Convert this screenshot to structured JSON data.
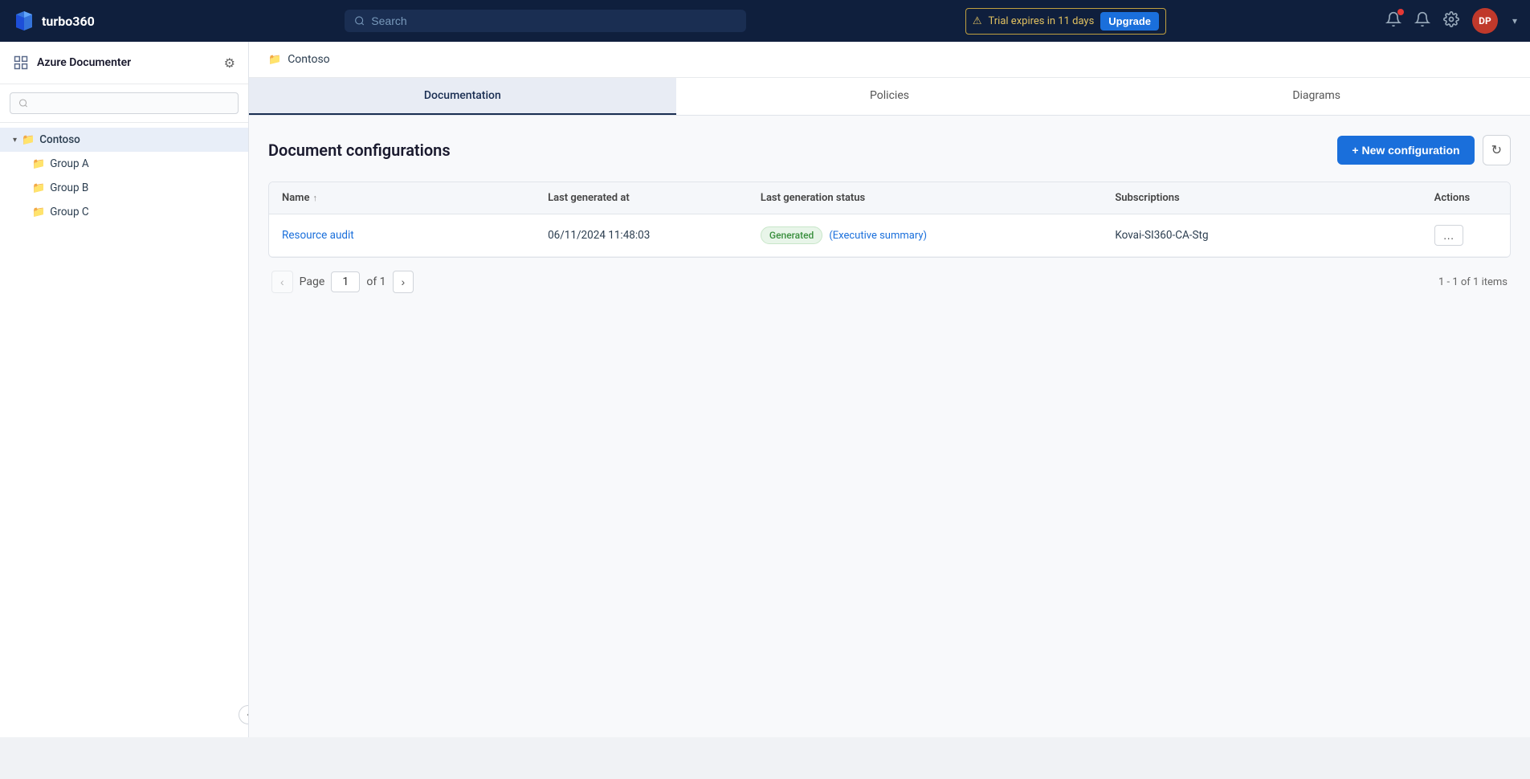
{
  "app": {
    "name": "turbo360",
    "logo_text": "turbo360"
  },
  "topnav": {
    "search_placeholder": "Search",
    "trial_text": "Trial expires in 11 days",
    "upgrade_label": "Upgrade",
    "avatar_initials": "DP"
  },
  "sidebar": {
    "module_name": "Azure Documenter",
    "search_placeholder": "",
    "tree": [
      {
        "id": "contoso",
        "label": "Contoso",
        "indent": 0,
        "active": true,
        "has_chevron": true,
        "expanded": true
      },
      {
        "id": "group-a",
        "label": "Group A",
        "indent": 1,
        "active": false
      },
      {
        "id": "group-b",
        "label": "Group B",
        "indent": 1,
        "active": false
      },
      {
        "id": "group-c",
        "label": "Group C",
        "indent": 1,
        "active": false
      }
    ],
    "collapse_label": "<"
  },
  "breadcrumb": {
    "folder_label": "Contoso"
  },
  "tabs": [
    {
      "id": "documentation",
      "label": "Documentation",
      "active": true
    },
    {
      "id": "policies",
      "label": "Policies",
      "active": false
    },
    {
      "id": "diagrams",
      "label": "Diagrams",
      "active": false
    }
  ],
  "document_configs": {
    "title": "Document configurations",
    "new_config_label": "+ New configuration",
    "refresh_label": "↻",
    "table": {
      "columns": [
        {
          "id": "name",
          "label": "Name",
          "sortable": true
        },
        {
          "id": "last_generated_at",
          "label": "Last generated at"
        },
        {
          "id": "last_generation_status",
          "label": "Last generation status"
        },
        {
          "id": "subscriptions",
          "label": "Subscriptions"
        },
        {
          "id": "actions",
          "label": "Actions"
        }
      ],
      "rows": [
        {
          "name": "Resource audit",
          "last_generated_at": "06/11/2024 11:48:03",
          "status": "Generated",
          "status_extra": "(Executive summary)",
          "subscriptions": "Kovai-SI360-CA-Stg",
          "actions": "…"
        }
      ]
    },
    "pagination": {
      "page_label": "Page",
      "current_page": "1",
      "of_label": "of 1",
      "prev_label": "‹",
      "next_label": "›",
      "items_info": "1 - 1 of 1 items"
    }
  }
}
